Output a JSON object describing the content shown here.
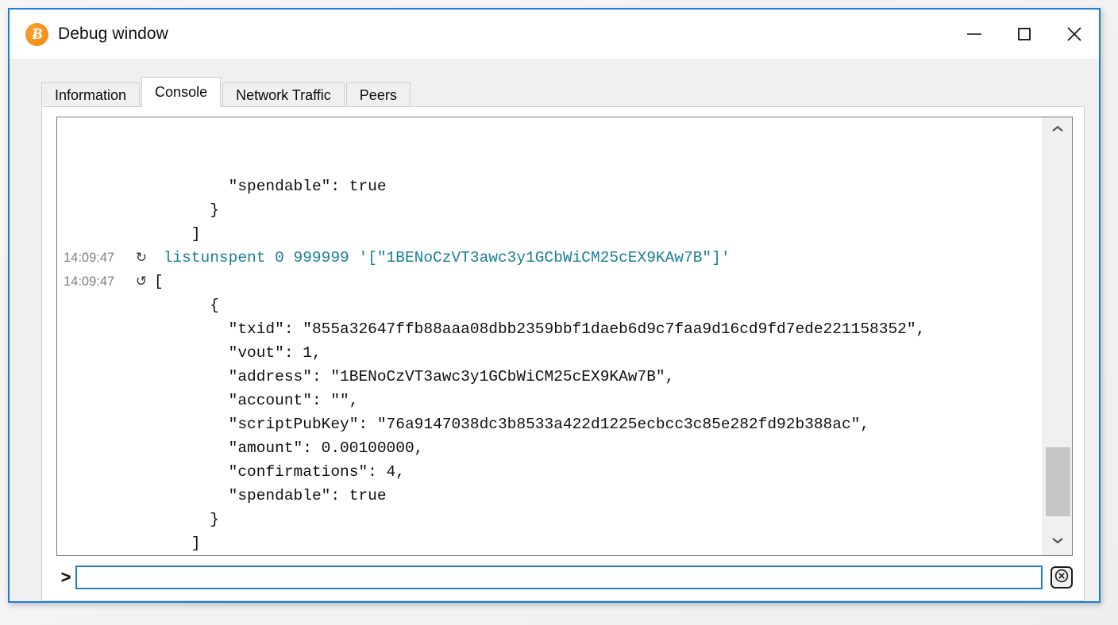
{
  "window": {
    "title": "Debug window",
    "logo_icon": "bitcoin-logo-icon",
    "logo_glyph": "Ƀ",
    "controls": {
      "minimize": "minimize-icon",
      "maximize": "maximize-icon",
      "close": "close-icon"
    }
  },
  "tabs": [
    {
      "label": "Information",
      "active": false
    },
    {
      "label": "Console",
      "active": true
    },
    {
      "label": "Network Traffic",
      "active": false
    },
    {
      "label": "Peers",
      "active": false
    }
  ],
  "console": {
    "messages": [
      {
        "kind": "plain",
        "timestamp": "",
        "direction": "",
        "text": "        \"spendable\": true"
      },
      {
        "kind": "plain",
        "timestamp": "",
        "direction": "",
        "text": "      }"
      },
      {
        "kind": "plain",
        "timestamp": "",
        "direction": "",
        "text": "    ]"
      },
      {
        "kind": "cmd",
        "timestamp": "14:09:47",
        "direction": "↻",
        "text": " listunspent 0 999999 '[\"1BENoCzVT3awc3y1GCbWiCM25cEX9KAw7B\"]'"
      },
      {
        "kind": "reply",
        "timestamp": "14:09:47",
        "direction": "↺",
        "text": "["
      },
      {
        "kind": "plain",
        "timestamp": "",
        "direction": "",
        "text": "      {"
      },
      {
        "kind": "plain",
        "timestamp": "",
        "direction": "",
        "text": "        \"txid\": \"855a32647ffb88aaa08dbb2359bbf1daeb6d9c7faa9d16cd9fd7ede221158352\","
      },
      {
        "kind": "plain",
        "timestamp": "",
        "direction": "",
        "text": "        \"vout\": 1,"
      },
      {
        "kind": "plain",
        "timestamp": "",
        "direction": "",
        "text": "        \"address\": \"1BENoCzVT3awc3y1GCbWiCM25cEX9KAw7B\","
      },
      {
        "kind": "plain",
        "timestamp": "",
        "direction": "",
        "text": "        \"account\": \"\","
      },
      {
        "kind": "plain",
        "timestamp": "",
        "direction": "",
        "text": "        \"scriptPubKey\": \"76a9147038dc3b8533a422d1225ecbcc3c85e282fd92b388ac\","
      },
      {
        "kind": "plain",
        "timestamp": "",
        "direction": "",
        "text": "        \"amount\": 0.00100000,"
      },
      {
        "kind": "plain",
        "timestamp": "",
        "direction": "",
        "text": "        \"confirmations\": 4,"
      },
      {
        "kind": "plain",
        "timestamp": "",
        "direction": "",
        "text": "        \"spendable\": true"
      },
      {
        "kind": "plain",
        "timestamp": "",
        "direction": "",
        "text": "      }"
      },
      {
        "kind": "plain",
        "timestamp": "",
        "direction": "",
        "text": "    ]"
      }
    ],
    "scrollbar": {
      "up_icon": "chevron-up-icon",
      "down_icon": "chevron-down-icon",
      "thumb_top_pct": 79,
      "thumb_height_pct": 18
    }
  },
  "command_bar": {
    "prompt": ">",
    "value": "",
    "placeholder": "",
    "clear_icon": "clear-circle-x-icon"
  },
  "colors": {
    "window_border": "#1a7fd4",
    "accent": "#1a7fd4",
    "command_text": "#1a7f96",
    "timestamp_text": "#808080",
    "bitcoin_orange": "#f7931a",
    "panel_background": "#ffffff",
    "chrome_background": "#f0f0f0"
  }
}
